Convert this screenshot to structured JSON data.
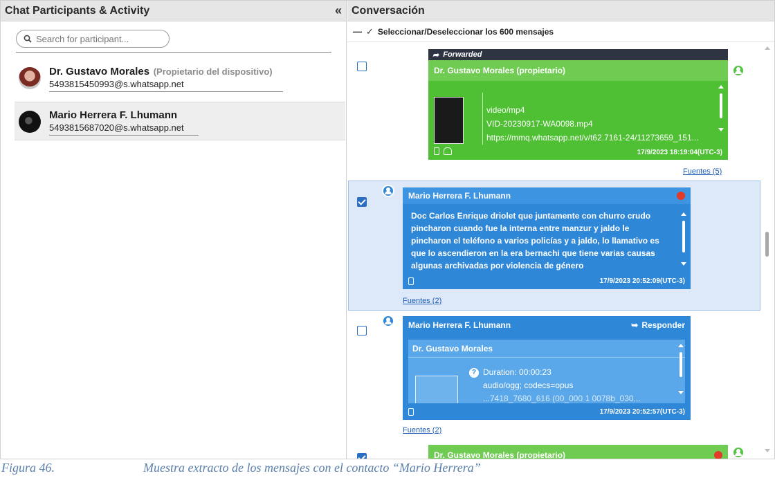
{
  "left_panel": {
    "title": "Chat Participants & Activity",
    "collapse_glyph": "«",
    "search": {
      "placeholder": "Search for participant..."
    },
    "participants": [
      {
        "name": "Dr. Gustavo Morales",
        "role": "(Propietario del dispositivo)",
        "jid": "5493815450993@s.whatsapp.net"
      },
      {
        "name": "Mario Herrera F. Lhumann",
        "role": "",
        "jid": "5493815687020@s.whatsapp.net"
      }
    ]
  },
  "conversation": {
    "title": "Conversación",
    "select_all_label": "Seleccionar/Deseleccionar los 600 mensajes",
    "messages": [
      {
        "forwarded_label": "Forwarded",
        "sender": "Dr. Gustavo Morales (propietario)",
        "attachment_type": "video/mp4",
        "attachment_name": "VID-20230917-WA0098.mp4",
        "attachment_url": "https://mmq.whatsapp.net/v/t62.7161-24/11273659_151...",
        "timestamp": "17/9/2023 18:19:04(UTC-3)",
        "sources": "Fuentes (5)",
        "selected": false
      },
      {
        "sender": "Mario Herrera F. Lhumann",
        "body": "Doc Carlos  Enrique driolet que juntamente con churro crudo pincharon cuando fue la interna entre manzur y jaldo le pincharon el teléfono a varios policías y a jaldo, lo llamativo es que lo ascendieron en la era bernachi que tiene varias causas algunas archivadas por violencia de género",
        "timestamp": "17/9/2023 20:52:09(UTC-3)",
        "sources": "Fuentes (2)",
        "selected": true
      },
      {
        "sender": "Mario Herrera F. Lhumann",
        "reply_label": "Responder",
        "quoted_sender": "Dr. Gustavo Morales",
        "duration": "Duration: 00:00:23",
        "attachment_type": "audio/ogg; codecs=opus",
        "attachment_partial": "...7418_7680_616 (00_000 1 0078b_030...",
        "timestamp": "17/9/2023 20:52:57(UTC-3)",
        "sources": "Fuentes (2)",
        "selected": false
      },
      {
        "sender": "Dr. Gustavo Morales (propietario)",
        "selected": true
      }
    ]
  },
  "caption": {
    "number": "Figura 46.",
    "text": "Muestra extracto de los mensajes con el contacto “Mario Herrera”"
  },
  "colors": {
    "owner_green": "#59c248",
    "contact_blue": "#2f87d8",
    "selected_row": "#dde9f8",
    "forwarded_bar": "#2e3442"
  }
}
